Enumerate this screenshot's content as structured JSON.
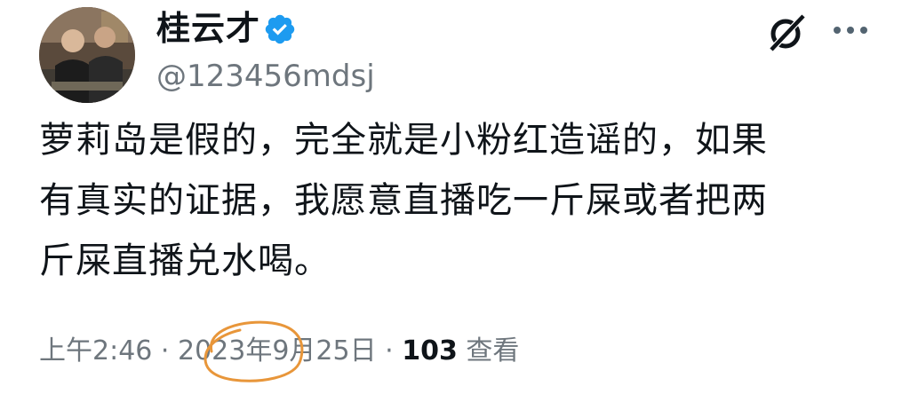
{
  "post": {
    "author": {
      "display_name": "桂云才",
      "handle": "@123456mdsj",
      "verified": true
    },
    "text": "萝莉岛是假的，完全就是小粉红造谣的，如果\n有真实的证据，我愿意直播吃一斤屎或者把两\n斤屎直播兑水喝。",
    "meta": {
      "time": "上午2:46",
      "separator": " · ",
      "date": "2023年9月25日",
      "separator2": " · ",
      "views_count": "103",
      "views_label": " 查看"
    }
  },
  "icons": {
    "verified": "verified-badge-icon",
    "grok": "grok-icon",
    "more": "more-options-icon"
  },
  "colors": {
    "verified_blue": "#1d9bf0",
    "secondary_text": "#6e767d",
    "annotation_orange": "#e8963a"
  }
}
